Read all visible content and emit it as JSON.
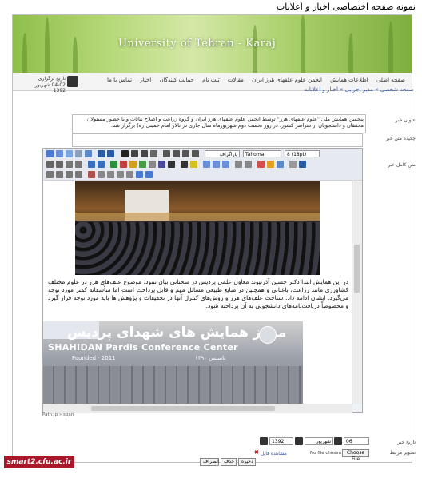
{
  "caption": "نمونه صفحه اختصاصی اخبار و اعلانات",
  "banner": {
    "title": "University of Tehran - Karaj"
  },
  "date_box": {
    "label": "تاریخ برگزاری",
    "value": "04-02 شهریور 1392"
  },
  "nav": {
    "items": [
      "صفحه اصلی",
      "اطلاعات همایش",
      "انجمن علوم علفهای هرز ایران",
      "مقالات",
      "ثبت نام",
      "حمایت کنندگان",
      "اخبار",
      "تماس با ما"
    ]
  },
  "breadcrumb": "صفحه شخصی » مدیر اجرایی » اخبار و اعلانات",
  "labels": {
    "title": "عنوان خبر",
    "summary": "چکیده متن خبر",
    "full_text": "متن کامل خبر",
    "date": "تاریخ خبر",
    "image": "تصویر مرتبط"
  },
  "fields": {
    "title_value": "پنجمین همایش ملی \"علوم علفهای هرز\" توسط انجمن علوم علفهای هرز ایران و گروه زراعت و اصلاح نباتات و با حضور مسئولان، محققان و دانشجویان از سراسر کشور، در روز نخست دوم شهریورماه سال جاری در تالار امام خمینی(ره) برگزار شد.",
    "summary_value": ""
  },
  "editor": {
    "font_size": "8 (18pt)",
    "font_family": "Tahoma",
    "format": "پاراگراف",
    "paragraph": "در این همایش ابتدا دکتر حسین آذرنیوند معاون علمی پردیس در سخنانی بیان نمود: موضوع علف‌های هرز در علوم مختلف کشاورزی مانند زراعت، باغبانی و همچنین در منابع طبیعی مسائل مهم و قابل پرداخت است اما متأسفانه کمتر مورد توجه می‌گیرد. ایشان ادامه داد: شناخت علف‌های هرز و روش‌های کنترل آنها در تحقیقات و پژوهش ها باید مورد توجه قرار گیرد و مخصوصاً دریافت‌نامه‌های دانشجویی به آن پرداخته شود.",
    "sign_fa": "مرکز همایش های شهدای پردیس",
    "sign_en": "SHAHIDAN Pardis Conference Center",
    "founded": "Founded · 2011",
    "founded_fa": "تاسیس ۱۳۹۰",
    "status_path": "Path: p » span"
  },
  "date": {
    "day": "06",
    "month": "شهریور",
    "year": "1392"
  },
  "file": {
    "button": "Choose File",
    "status": "No file chosen",
    "view": "مشاهده فایل"
  },
  "actions": {
    "save": "ذخیره",
    "delete": "حذف",
    "cancel": "انصراف"
  },
  "footer_logo": "smart2.cfu.ac.ir",
  "colors": {
    "accent_link": "#3355aa",
    "logo_bg": "#a8182a",
    "banner_green": "#8fbf4a"
  }
}
